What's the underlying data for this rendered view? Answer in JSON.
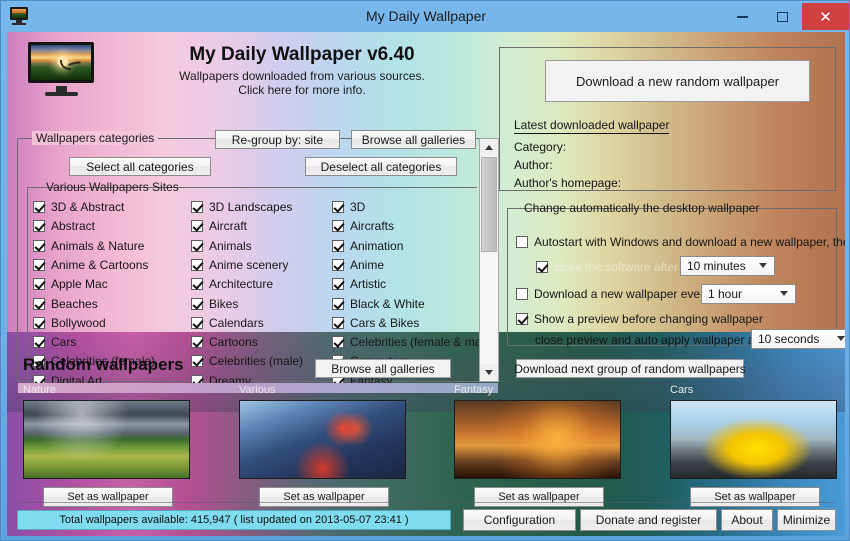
{
  "window": {
    "title": "My Daily Wallpaper",
    "icon": "monitor-wallpaper-icon",
    "minimize_label": "Minimize",
    "maximize_label": "Maximize",
    "close_label": "Close",
    "accent_close": "#cf4040",
    "accent_titlebar": "#76b6ea"
  },
  "header": {
    "app_title": "My Daily Wallpaper v6.40",
    "subtitle_line1": "Wallpapers downloaded from various sources.",
    "subtitle_line2": "Click here for more info."
  },
  "categories_panel": {
    "group_title": "Wallpapers categories",
    "regroup_button": "Re-group by: site",
    "browse_button": "Browse all galleries",
    "select_all_button": "Select all categories",
    "deselect_all_button": "Deselect all categories",
    "sites_group_title": "Various Wallpapers Sites",
    "rows": [
      {
        "c1": "3D & Abstract",
        "c2": "3D Landscapes",
        "c3": "3D"
      },
      {
        "c1": "Abstract",
        "c2": "Aircraft",
        "c3": "Aircrafts"
      },
      {
        "c1": "Animals & Nature",
        "c2": "Animals",
        "c3": "Animation"
      },
      {
        "c1": "Anime & Cartoons",
        "c2": "Anime scenery",
        "c3": "Anime"
      },
      {
        "c1": "Apple Mac",
        "c2": "Architecture",
        "c3": "Artistic"
      },
      {
        "c1": "Beaches",
        "c2": "Bikes",
        "c3": "Black & White"
      },
      {
        "c1": "Bollywood",
        "c2": "Calendars",
        "c3": "Cars & Bikes"
      },
      {
        "c1": "Cars",
        "c2": "Cartoons",
        "c3": "Celebrities (female & male)"
      },
      {
        "c1": "Celebrities (female)",
        "c2": "Celebrities (male)",
        "c3": "Computers"
      },
      {
        "c1": "Digital Art",
        "c2": "Dreamy",
        "c3": "Fantasy"
      }
    ],
    "all_checked": true,
    "scrollbar": {
      "up_icon": "chevron-up-icon",
      "down_icon": "chevron-down-icon"
    }
  },
  "download_panel": {
    "download_button": "Download a new random wallpaper",
    "latest_label": "Latest downloaded wallpaper",
    "category_label": "Category:",
    "author_label": "Author:",
    "homepage_label": "Author's homepage:",
    "category_value": "",
    "author_value": "",
    "homepage_value": ""
  },
  "auto_panel": {
    "group_title": "Change automatically the desktop wallpaper",
    "autostart_label": "Autostart with Windows and download a new wallpaper, then:",
    "autostart_checked": false,
    "close_after_label": "close the software after",
    "close_after_checked": true,
    "close_after_disabled": true,
    "close_after_value": "10 minutes",
    "download_every_label": "Download a new wallpaper every",
    "download_every_checked": false,
    "download_every_value": "1 hour",
    "preview_label": "Show a preview before changing wallpaper",
    "preview_checked": true,
    "auto_apply_label": "close preview and auto apply wallpaper after",
    "auto_apply_value": "10 seconds"
  },
  "random_panel": {
    "title": "Random wallpapers",
    "browse_button": "Browse all galleries",
    "download_next_button": "Download next group of random wallpapers",
    "thumbs": [
      {
        "label": "Nature",
        "set_button": "Set as wallpaper"
      },
      {
        "label": "Various",
        "set_button": "Set as wallpaper"
      },
      {
        "label": "Fantasy",
        "set_button": "Set as wallpaper"
      },
      {
        "label": "Cars",
        "set_button": "Set as wallpaper"
      }
    ]
  },
  "statusbar": {
    "text": "Total wallpapers available: 415,947 ( list updated on 2013-05-07 23:41 )",
    "configuration_button": "Configuration",
    "donate_button": "Donate and register",
    "about_button": "About",
    "minimize_button": "Minimize",
    "background": "#7fdcef"
  }
}
